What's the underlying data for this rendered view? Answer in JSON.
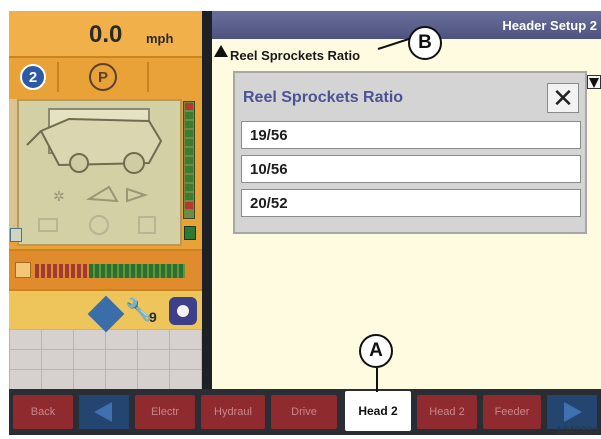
{
  "speed": {
    "value": "0.0",
    "unit": "mph"
  },
  "gear": {
    "number": "2",
    "park": "P"
  },
  "tools": {
    "count": "9"
  },
  "header": {
    "title": "Header Setup 2"
  },
  "field": {
    "label": "Reel Sprockets Ratio"
  },
  "popup": {
    "title": "Reel Sprockets Ratio",
    "close_glyph": "✕",
    "options": [
      "19/56",
      "10/56",
      "20/52"
    ]
  },
  "callouts": {
    "a": "A",
    "b": "B"
  },
  "nav": {
    "back": "Back",
    "items": [
      "Electr",
      "Hydraul",
      "Drive",
      "Head 2",
      "Head 2",
      "Feeder"
    ],
    "active_index": 3
  },
  "figure_id": "1042890",
  "colors": {
    "accent_orange": "#e8a238",
    "header_purple": "#4d527e",
    "nav_red": "#8f2a2e",
    "nav_blue": "#24456f",
    "popup_title": "#4c5395"
  }
}
